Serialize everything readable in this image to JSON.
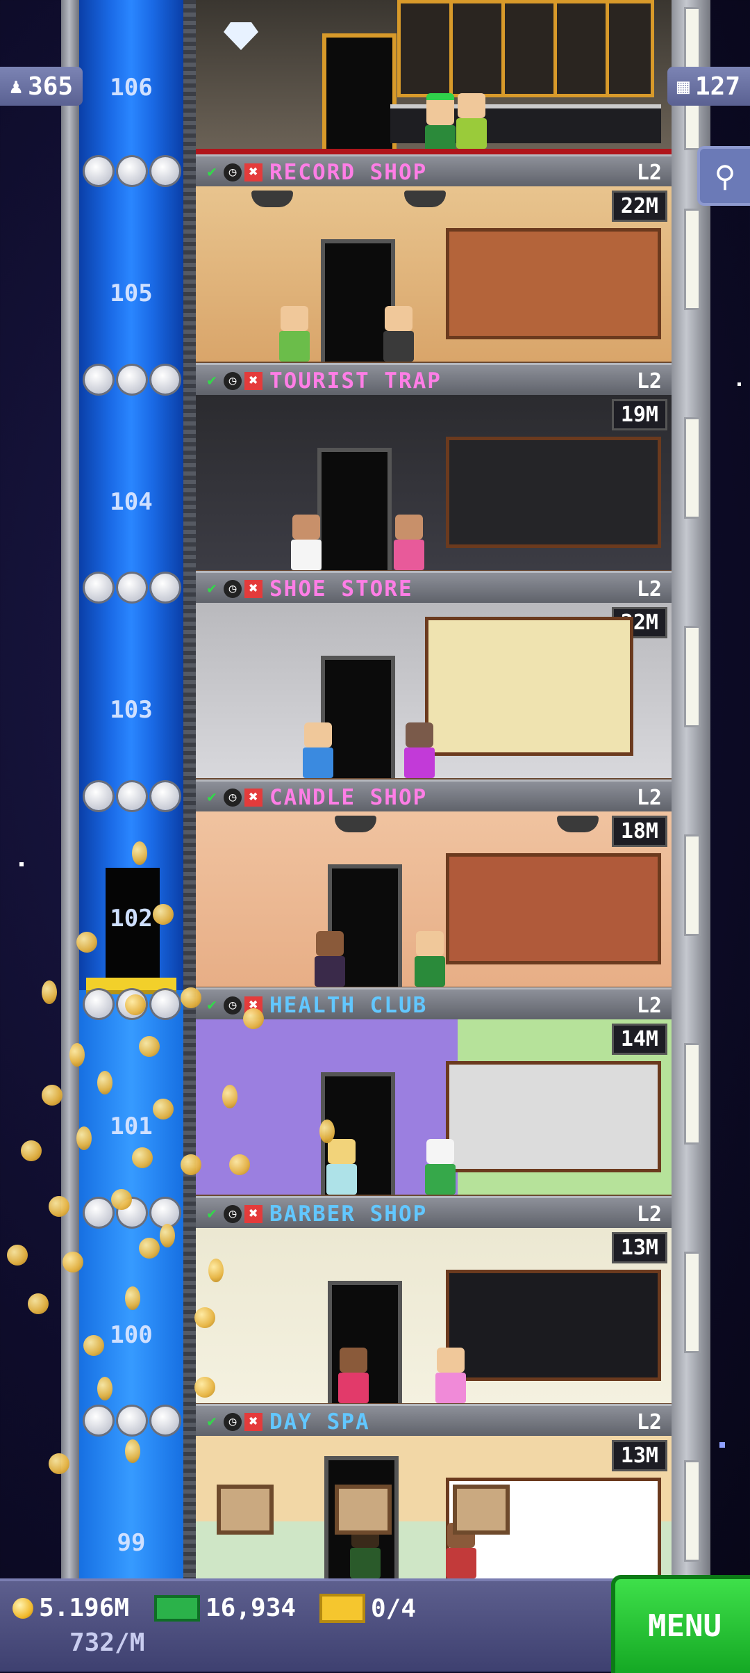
{
  "top_counters": {
    "population": "365",
    "floors": "127"
  },
  "floors": [
    {
      "number": "105",
      "name": "RECORD SHOP",
      "level": "L2",
      "income": "22M",
      "name_color": "#ff7ee6"
    },
    {
      "number": "104",
      "name": "TOURIST TRAP",
      "level": "L2",
      "income": "19M",
      "name_color": "#ff7ee6"
    },
    {
      "number": "103",
      "name": "SHOE STORE",
      "level": "L2",
      "income": "22M",
      "name_color": "#ff7ee6"
    },
    {
      "number": "102",
      "name": "CANDLE SHOP",
      "level": "L2",
      "income": "18M",
      "name_color": "#ff7ee6"
    },
    {
      "number": "101",
      "name": "HEALTH CLUB",
      "level": "L2",
      "income": "14M",
      "name_color": "#62c7ff"
    },
    {
      "number": "100",
      "name": "BARBER SHOP",
      "level": "L2",
      "income": "13M",
      "name_color": "#62c7ff"
    },
    {
      "number": "99",
      "name": "DAY SPA",
      "level": "L2",
      "income": "13M",
      "name_color": "#62c7ff"
    }
  ],
  "top_floor": {
    "number": "106"
  },
  "bottom_bar": {
    "coins": "5.196M",
    "coin_rate": "732/M",
    "bux": "16,934",
    "tickets": "0/4",
    "menu_label": "MENU"
  },
  "icons": {
    "population": "person-icon",
    "floors": "building-icon",
    "search": "magnifier-icon",
    "coin": "coin-icon",
    "bux": "tower-bux-icon",
    "ticket": "golden-ticket-icon"
  }
}
